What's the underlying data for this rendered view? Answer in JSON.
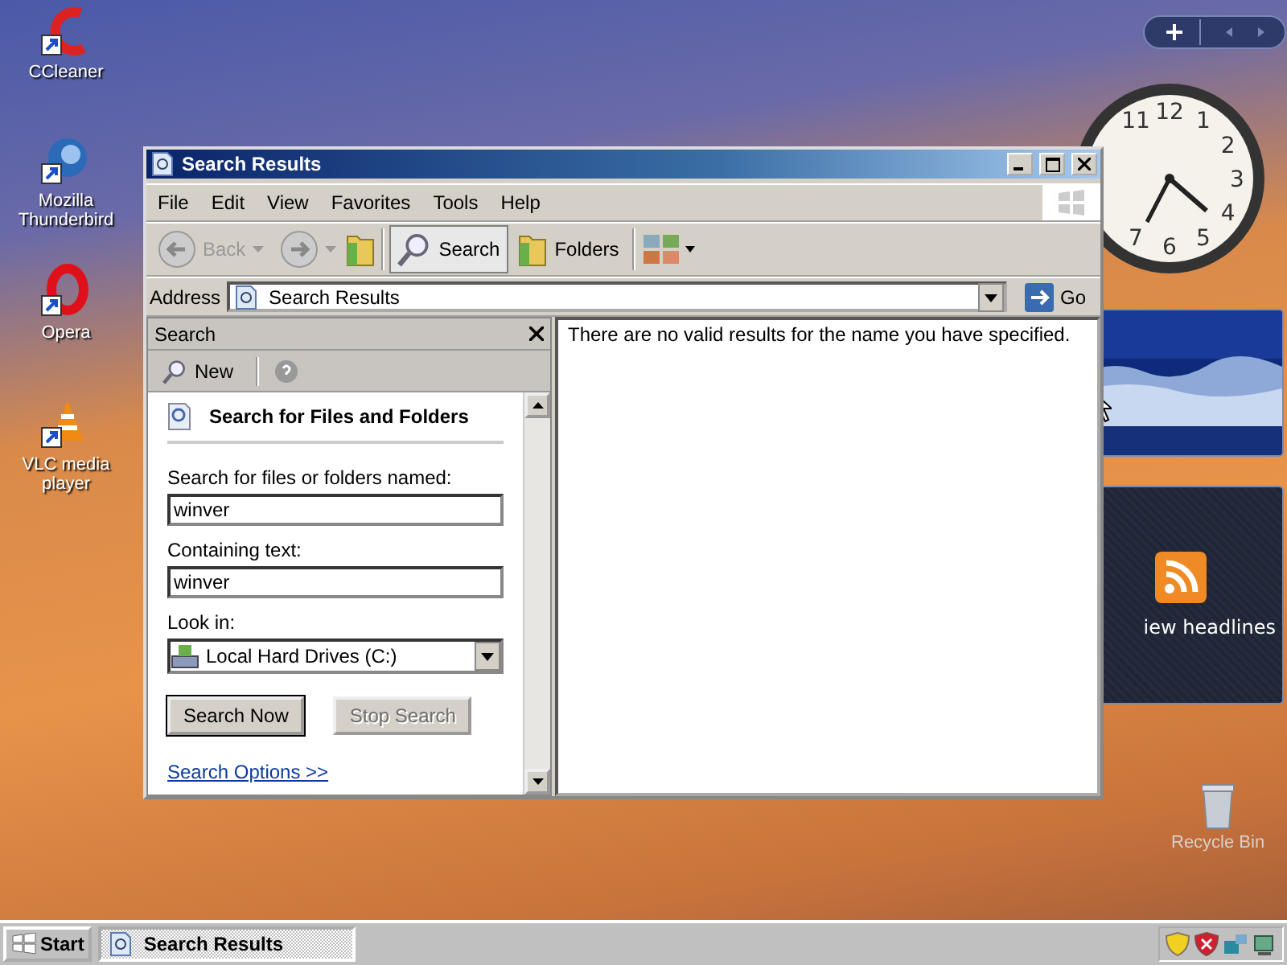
{
  "desktop_icons": [
    {
      "label": "CCleaner",
      "kind": "ccleaner"
    },
    {
      "label": "Mozilla Thunderbird",
      "kind": "thunderbird"
    },
    {
      "label": "Opera",
      "kind": "opera"
    },
    {
      "label": "VLC media player",
      "kind": "vlc"
    }
  ],
  "clock": {
    "numerals": [
      "11",
      "12",
      "1",
      "2",
      "3",
      "4",
      "5",
      "6",
      "7"
    ]
  },
  "feed_gadget": {
    "label": "iew headlines"
  },
  "recycle_bin": {
    "label": "Recycle Bin"
  },
  "window": {
    "title": "Search Results",
    "menu": [
      "File",
      "Edit",
      "View",
      "Favorites",
      "Tools",
      "Help"
    ],
    "toolbar": {
      "back": {
        "label": "Back",
        "disabled": true
      },
      "search": {
        "label": "Search",
        "selected": true
      },
      "folders": {
        "label": "Folders",
        "selected": false
      }
    },
    "address": {
      "label": "Address",
      "value": "Search Results",
      "go": "Go"
    },
    "search_pane": {
      "title": "Search",
      "new": "New",
      "heading": "Search for Files and Folders",
      "fields": [
        {
          "label": "Search for files or folders named:",
          "value": "winver"
        },
        {
          "label": "Containing text:",
          "value": "winver"
        }
      ],
      "look_in": {
        "label": "Look in:",
        "value": "Local Hard Drives (C:)"
      },
      "buttons": [
        {
          "label": "Search Now",
          "disabled": false
        },
        {
          "label": "Stop Search",
          "disabled": true
        }
      ],
      "options_link": "Search Options >>"
    },
    "results": {
      "message": "There are no valid results for the name you have specified."
    }
  },
  "taskbar": {
    "start": "Start",
    "tasks": [
      {
        "label": "Search Results",
        "selected": true
      }
    ]
  }
}
